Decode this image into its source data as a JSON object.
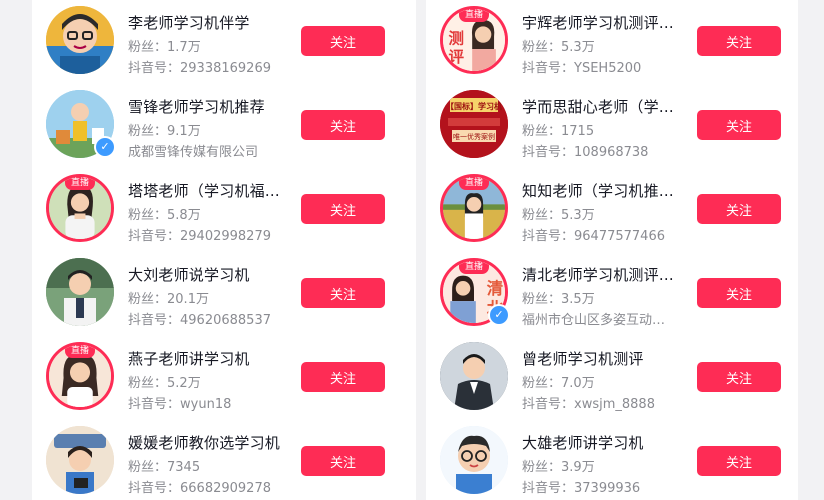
{
  "follow_label": "关注",
  "live_label": "直播",
  "left": [
    {
      "name": "李老师学习机伴学",
      "fans_label": "粉丝：",
      "fans": "1.7万",
      "id_label": "抖音号：",
      "id": "29338169269",
      "live": false,
      "verified": false,
      "avatar_color": "#eeb63c"
    },
    {
      "name": "雪锋老师学习机推荐",
      "fans_label": "粉丝：",
      "fans": "9.1万",
      "id_label": "",
      "id": "成都雪锋传媒有限公司",
      "live": false,
      "verified": true,
      "avatar_color": "#7ec0e6"
    },
    {
      "name": "塔塔老师（学习机福…",
      "fans_label": "粉丝：",
      "fans": "5.8万",
      "id_label": "抖音号：",
      "id": "29402998279",
      "live": true,
      "verified": false,
      "avatar_color": "#c9d7a8"
    },
    {
      "name": "大刘老师说学习机",
      "fans_label": "粉丝：",
      "fans": "20.1万",
      "id_label": "抖音号：",
      "id": "49620688537",
      "live": false,
      "verified": false,
      "avatar_color": "#6f8f6a"
    },
    {
      "name": "燕子老师讲学习机",
      "fans_label": "粉丝：",
      "fans": "5.2万",
      "id_label": "抖音号：",
      "id": "wyun18",
      "live": true,
      "verified": false,
      "avatar_color": "#f1d7c4"
    },
    {
      "name": "媛媛老师教你选学习机",
      "fans_label": "粉丝：",
      "fans": "7345",
      "id_label": "抖音号：",
      "id": "66682909278",
      "live": false,
      "verified": false,
      "avatar_color": "#e9d7c1"
    }
  ],
  "right": [
    {
      "name": "宇辉老师学习机测评…",
      "fans_label": "粉丝：",
      "fans": "5.3万",
      "id_label": "抖音号：",
      "id": "YSEH5200",
      "live": true,
      "verified": false,
      "avatar_color": "#fbe6d5"
    },
    {
      "name": "学而思甜心老师（学…",
      "fans_label": "粉丝：",
      "fans": "1715",
      "id_label": "抖音号：",
      "id": "108968738",
      "live": false,
      "verified": false,
      "avatar_color": "#b3121c"
    },
    {
      "name": "知知老师（学习机推…",
      "fans_label": "粉丝：",
      "fans": "5.3万",
      "id_label": "抖音号：",
      "id": "96477577466",
      "live": true,
      "verified": false,
      "avatar_color": "#d9b44a"
    },
    {
      "name": "清北老师学习机测评…",
      "fans_label": "粉丝：",
      "fans": "3.5万",
      "id_label": "",
      "id": "福州市仓山区多姿互动…",
      "live": true,
      "verified": true,
      "avatar_color": "#fbe1d8"
    },
    {
      "name": "曾老师学习机测评",
      "fans_label": "粉丝：",
      "fans": "7.0万",
      "id_label": "抖音号：",
      "id": "xwsjm_8888",
      "live": false,
      "verified": false,
      "avatar_color": "#3d4550"
    },
    {
      "name": "大雄老师讲学习机",
      "fans_label": "粉丝：",
      "fans": "3.9万",
      "id_label": "抖音号：",
      "id": "37399936",
      "live": false,
      "verified": false,
      "avatar_color": "#dbe9f6"
    }
  ],
  "avatar_text": {
    "right_0": "测评",
    "right_1_top": "【国标】学习机",
    "right_1_bottom": "唯一优秀案例",
    "right_3": "清北"
  }
}
